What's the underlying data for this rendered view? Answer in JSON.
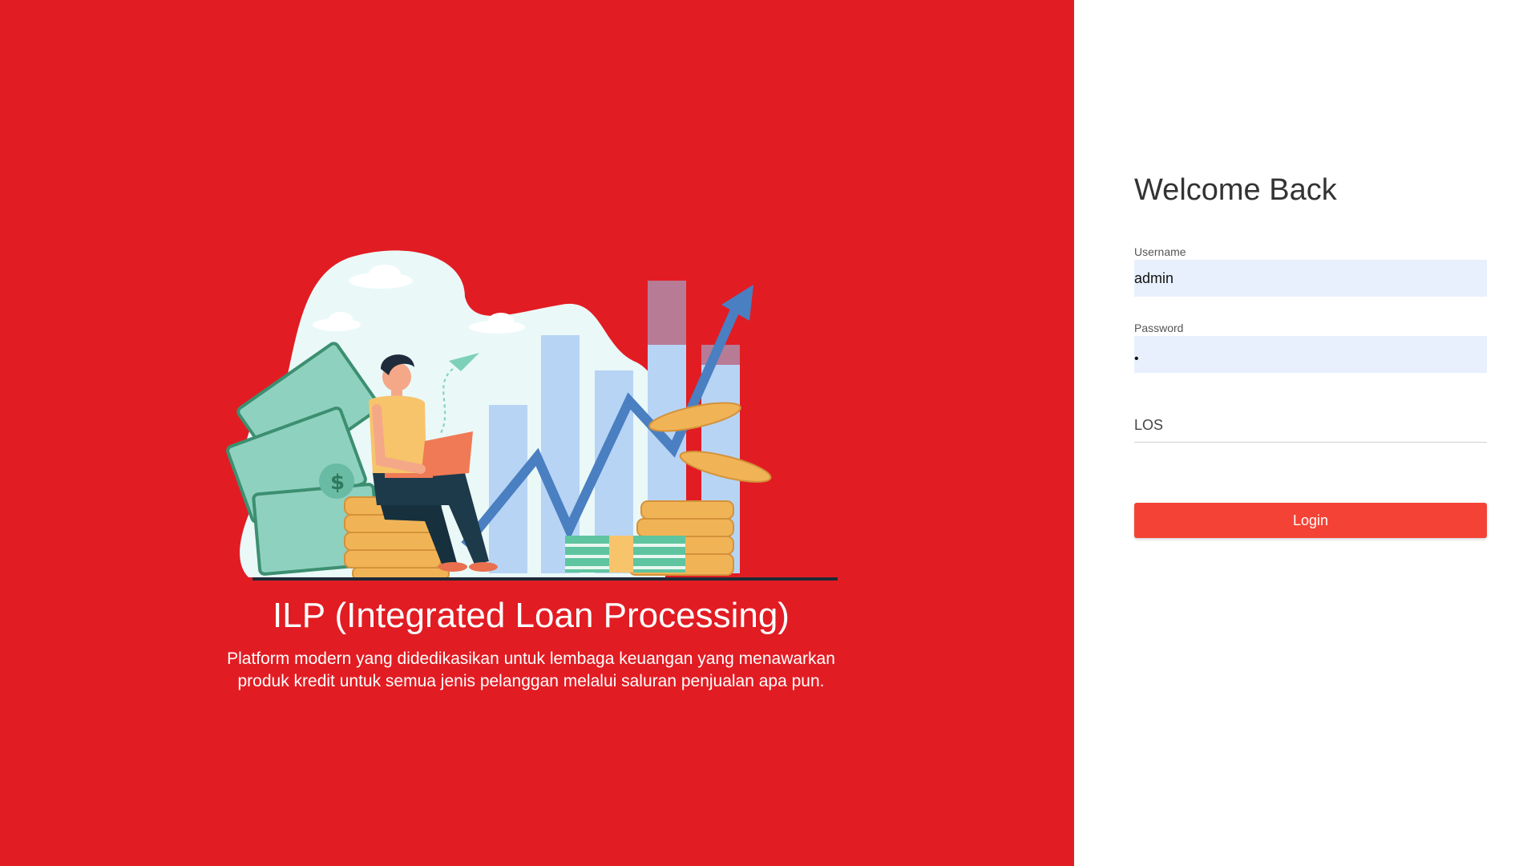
{
  "colors": {
    "brand_red": "#e21c23",
    "button_red": "#f44336",
    "input_bg": "#e8f0fe"
  },
  "hero": {
    "title": "ILP (Integrated Loan Processing)",
    "description": "Platform modern yang didedikasikan untuk lembaga keuangan yang menawarkan produk kredit untuk semua jenis pelanggan melalui saluran penjualan apa pun.",
    "illustration_icon": "person-with-laptop-on-coins-finance-icon"
  },
  "login_form": {
    "heading": "Welcome Back",
    "username": {
      "label": "Username",
      "value": "admin"
    },
    "password": {
      "label": "Password",
      "masked_value": "•"
    },
    "application": {
      "selected": "LOS"
    },
    "submit_label": "Login"
  }
}
